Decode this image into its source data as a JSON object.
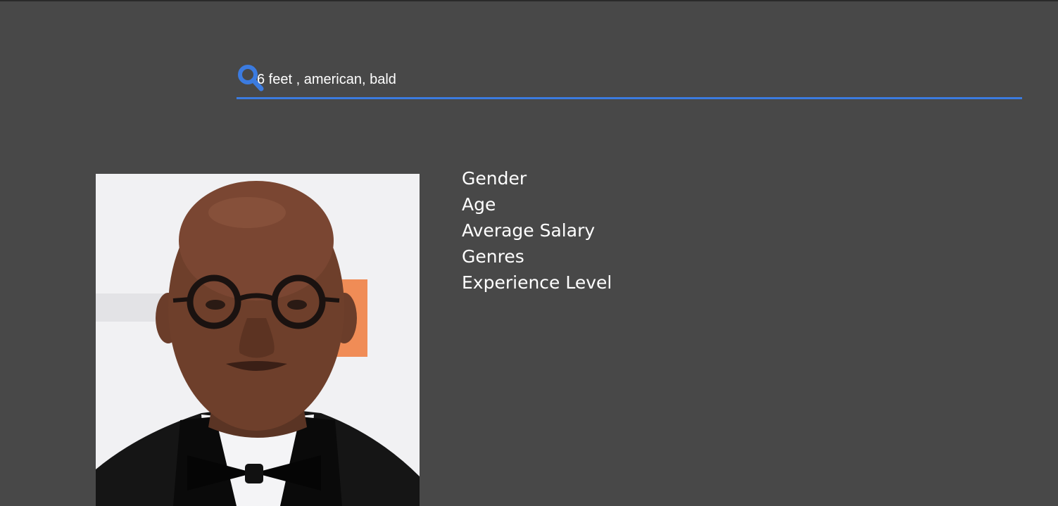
{
  "search": {
    "query": "6 feet , american, bald",
    "icon": "search-icon",
    "accent_color": "#3b7be0"
  },
  "result": {
    "photo_alt": "search-result-photo",
    "attributes": [
      {
        "label": "Gender"
      },
      {
        "label": "Age"
      },
      {
        "label": "Average Salary"
      },
      {
        "label": "Genres"
      },
      {
        "label": "Experience Level"
      }
    ]
  },
  "theme": {
    "background": "#484848",
    "text": "#ffffff"
  }
}
